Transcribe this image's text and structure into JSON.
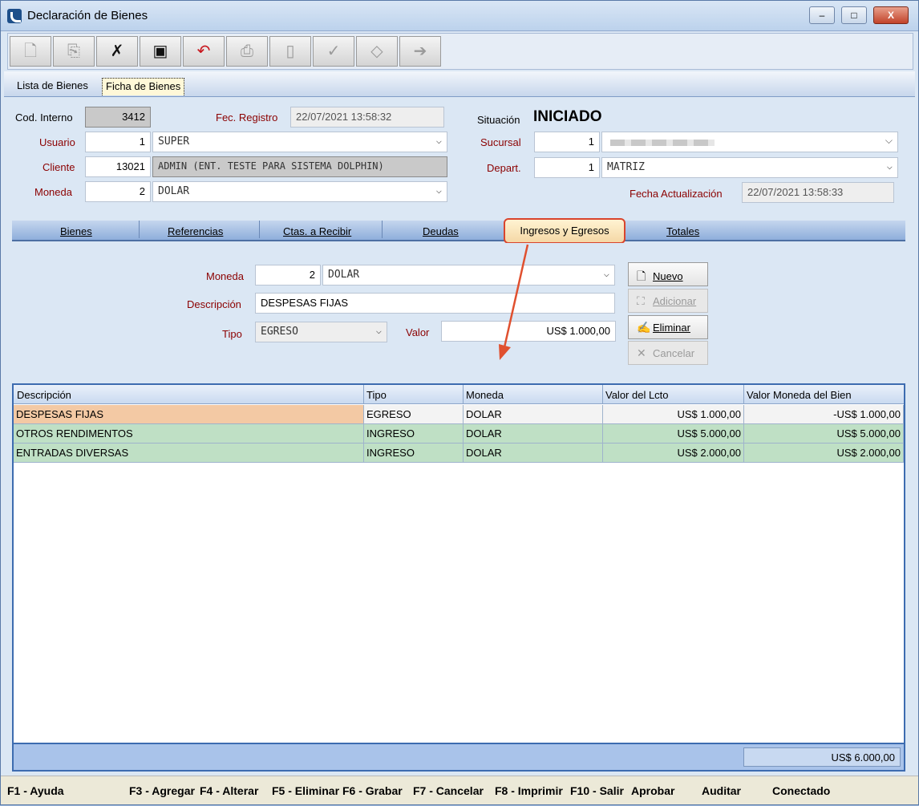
{
  "window": {
    "title": "Declaración de Bienes",
    "minimize": "–",
    "maximize": "□",
    "close": "X"
  },
  "page_tabs": [
    "Lista de Bienes",
    "Ficha de Bienes"
  ],
  "header_fields": {
    "cod_interno_label": "Cod. Interno",
    "cod_interno": "3412",
    "fec_registro_label": "Fec. Registro",
    "fec_registro": "22/07/2021 13:58:32",
    "situacion_label": "Situación",
    "situacion": "INICIADO",
    "usuario_label": "Usuario",
    "usuario_code": "1",
    "usuario_name": "SUPER",
    "sucursal_label": "Sucursal",
    "sucursal_code": "1",
    "cliente_label": "Cliente",
    "cliente_code": "13021",
    "cliente_name": "ADMIN  (ENT. TESTE PARA SISTEMA DOLPHIN)",
    "depart_label": "Depart.",
    "depart_code": "1",
    "depart_name": "MATRIZ",
    "moneda_label": "Moneda",
    "moneda_code": "2",
    "moneda_name": "DOLAR",
    "fecha_act_label": "Fecha Actualización",
    "fecha_act": "22/07/2021 13:58:33"
  },
  "sub_tabs": [
    "Bienes",
    "Referencias",
    "Ctas. a Recibir",
    "Deudas",
    "Ingresos y Egresos",
    "Totales"
  ],
  "detail": {
    "moneda_label": "Moneda",
    "moneda_code": "2",
    "moneda_name": "DOLAR",
    "descripcion_label": "Descripción",
    "descripcion": "DESPESAS FIJAS",
    "tipo_label": "Tipo",
    "tipo": "EGRESO",
    "valor_label": "Valor",
    "valor": "US$ 1.000,00"
  },
  "buttons": {
    "nuevo": "Nuevo",
    "adicionar": "Adicionar",
    "eliminar": "Eliminar",
    "cancelar": "Cancelar"
  },
  "grid": {
    "columns": [
      "Descripción",
      "Tipo",
      "Moneda",
      "Valor del Lcto",
      "Valor Moneda del Bien"
    ],
    "rows": [
      [
        "DESPESAS FIJAS",
        "EGRESO",
        "DOLAR",
        "US$ 1.000,00",
        "-US$ 1.000,00"
      ],
      [
        "OTROS RENDIMENTOS",
        "INGRESO",
        "DOLAR",
        "US$ 5.000,00",
        "US$ 5.000,00"
      ],
      [
        "ENTRADAS DIVERSAS",
        "INGRESO",
        "DOLAR",
        "US$ 2.000,00",
        "US$ 2.000,00"
      ]
    ],
    "total": "US$ 6.000,00"
  },
  "status_bar": [
    "F1 - Ayuda",
    "F3 - Agregar",
    "F4 - Alterar",
    "F5 - Eliminar",
    "F6 - Grabar",
    "F7 - Cancelar",
    "F8 - Imprimir",
    "F10 - Salir",
    "Aprobar",
    "Auditar",
    "Conectado"
  ],
  "colors": {
    "highlight_red": "#d9452d",
    "egreso_row": "#f3c9a4",
    "ingreso_row": "#bfe0c5"
  }
}
